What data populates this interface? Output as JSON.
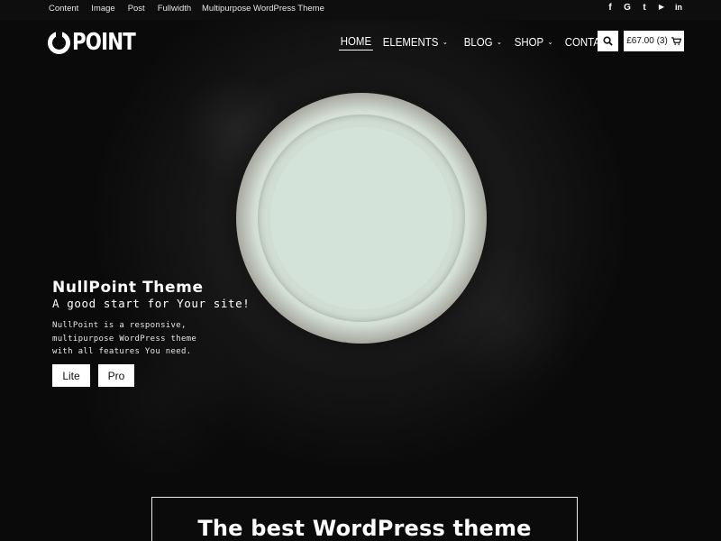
{
  "topbar": {
    "links": [
      "Content",
      "Image",
      "Post",
      "Fullwidth"
    ],
    "tagline": "Multipurpose WordPress Theme",
    "social": [
      {
        "name": "facebook-icon",
        "glyph": "f"
      },
      {
        "name": "google-icon",
        "glyph": "G"
      },
      {
        "name": "twitter-icon",
        "glyph": "t"
      },
      {
        "name": "youtube-icon",
        "glyph": "▶"
      },
      {
        "name": "linkedin-icon",
        "glyph": "in"
      }
    ]
  },
  "logo": {
    "text": "POINT"
  },
  "nav": {
    "items": [
      {
        "label": "HOME",
        "active": true,
        "dropdown": false
      },
      {
        "label": "ELEMENTS",
        "active": false,
        "dropdown": true
      },
      {
        "label": "BLOG",
        "active": false,
        "dropdown": true
      },
      {
        "label": "SHOP",
        "active": false,
        "dropdown": true
      },
      {
        "label": "CONTACT",
        "active": false,
        "dropdown": false
      }
    ],
    "cart_label": "£67.00 (3)",
    "search_icon": "search-icon",
    "cart_icon": "cart-icon"
  },
  "hero": {
    "title": "NullPoint Theme",
    "subtitle": "A good start for Your site!",
    "description": "NullPoint is a responsive, multipurpose WordPress theme with all features You need.",
    "buttons": {
      "lite": "Lite",
      "pro": "Pro"
    }
  },
  "section": {
    "heading": "The best WordPress theme"
  },
  "colors": {
    "background": "#0b0b0b",
    "text": "#ffffff",
    "button_bg": "#ffffff",
    "button_text": "#111111"
  }
}
